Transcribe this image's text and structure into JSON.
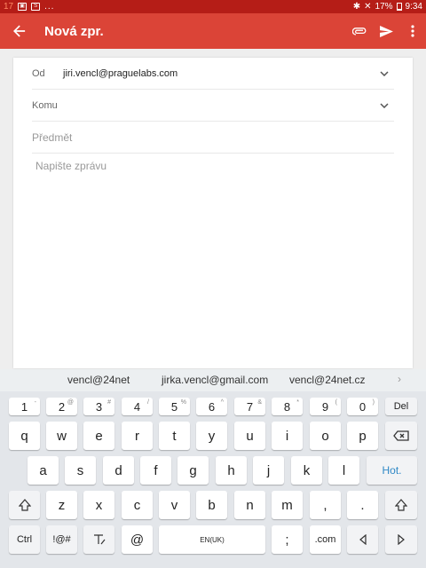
{
  "status_bar": {
    "notification_count": "17",
    "ellipsis": "...",
    "battery": "17%",
    "time": "9:34"
  },
  "app_bar": {
    "title": "Nová zpr.",
    "icons": [
      "back-arrow-icon",
      "attach-icon",
      "send-icon",
      "more-vert-icon"
    ]
  },
  "compose": {
    "from_label": "Od",
    "from_value": "jiri.vencl@praguelabs.com",
    "to_label": "Komu",
    "subject_placeholder": "Předmět",
    "body_placeholder": "Napište zprávu"
  },
  "suggestions": [
    "vencl@24net",
    "jirka.vencl@gmail.com",
    "vencl@24net.cz"
  ],
  "keyboard": {
    "number_row": [
      {
        "key": "1",
        "sup": "-"
      },
      {
        "key": "2",
        "sup": "@"
      },
      {
        "key": "3",
        "sup": "#"
      },
      {
        "key": "4",
        "sup": "/"
      },
      {
        "key": "5",
        "sup": "%"
      },
      {
        "key": "6",
        "sup": "^"
      },
      {
        "key": "7",
        "sup": "&"
      },
      {
        "key": "8",
        "sup": "*"
      },
      {
        "key": "9",
        "sup": "("
      },
      {
        "key": "0",
        "sup": ")"
      }
    ],
    "del_label": "Del",
    "row1": [
      "q",
      "w",
      "e",
      "r",
      "t",
      "y",
      "u",
      "i",
      "o",
      "p"
    ],
    "row2": [
      "a",
      "s",
      "d",
      "f",
      "g",
      "h",
      "j",
      "k",
      "l"
    ],
    "enter_label": "Hot.",
    "row3": [
      "z",
      "x",
      "c",
      "v",
      "b",
      "n",
      "m",
      ",",
      "."
    ],
    "ctrl_label": "Ctrl",
    "symbols_label": "!@#",
    "at_label": "@",
    "space_label": "EN(UK)",
    "semicolon_label": ";",
    "dotcom_label": ".com"
  }
}
